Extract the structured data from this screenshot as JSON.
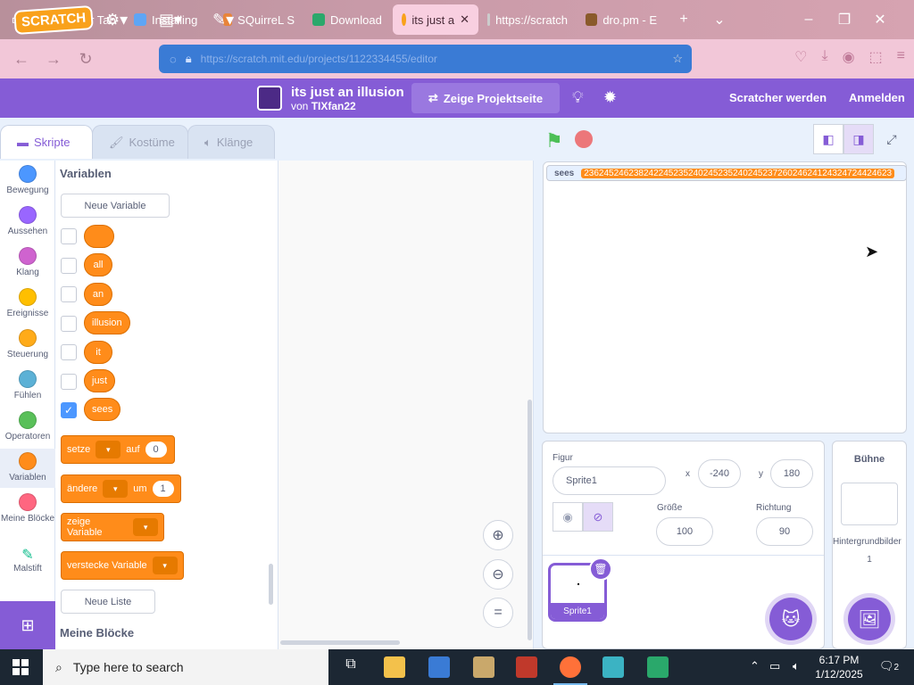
{
  "browser": {
    "tabs": [
      {
        "title": "Neuer Tab",
        "color": "#ff7139"
      },
      {
        "title": "Installing",
        "color": "#5ea5f5"
      },
      {
        "title": "SQuirreL S",
        "color": "#e8843a"
      },
      {
        "title": "Download",
        "color": "#2aa86b"
      },
      {
        "title": "its just a",
        "color": "#f9a11b",
        "active": true
      },
      {
        "title": "https://scratch",
        "color": "#cccccc"
      },
      {
        "title": "dro.pm - E",
        "color": "#8a5a2b"
      }
    ],
    "tab_close": "✕",
    "new_tab": "+",
    "url": "https://scratch.mit.edu/projects/1122334455/editor",
    "colors": {
      "tabbar": "#c89aa8",
      "urlbar": "#3a7bd5"
    }
  },
  "scratch": {
    "logo": "SCRATCH",
    "project_title": "its just an illusion",
    "author_prefix": "von",
    "author": "TIXfan22",
    "see_project": "Zeige Projektseite",
    "join": "Scratcher werden",
    "login": "Anmelden",
    "colors": {
      "menu": "#855cd6",
      "variables": "#ff8c1a"
    }
  },
  "tabs": {
    "code": "Skripte",
    "costumes": "Kostüme",
    "sounds": "Klänge"
  },
  "categories": [
    {
      "label": "Bewegung",
      "color": "#4c97ff"
    },
    {
      "label": "Aussehen",
      "color": "#9966ff"
    },
    {
      "label": "Klang",
      "color": "#cf63cf"
    },
    {
      "label": "Ereignisse",
      "color": "#ffbf00"
    },
    {
      "label": "Steuerung",
      "color": "#ffab19"
    },
    {
      "label": "Fühlen",
      "color": "#5cb1d6"
    },
    {
      "label": "Operatoren",
      "color": "#59c059"
    },
    {
      "label": "Variablen",
      "color": "#ff8c1a"
    },
    {
      "label": "Meine Blöcke",
      "color": "#ff6680"
    },
    {
      "label": "Malstift",
      "color": "#0fbd8c"
    }
  ],
  "palette": {
    "heading": "Variablen",
    "new_variable": "Neue Variable",
    "variables": [
      {
        "name": "",
        "checked": false
      },
      {
        "name": "all",
        "checked": false
      },
      {
        "name": "an",
        "checked": false
      },
      {
        "name": "illusion",
        "checked": false
      },
      {
        "name": "it",
        "checked": false
      },
      {
        "name": "just",
        "checked": false
      },
      {
        "name": "sees",
        "checked": true
      }
    ],
    "set_block": {
      "label": "setze",
      "to": "auf",
      "value": "0"
    },
    "change_block": {
      "label": "ändere",
      "by": "um",
      "value": "1"
    },
    "show_block": "zeige Variable",
    "hide_block": "verstecke Variable",
    "new_list": "Neue Liste",
    "my_blocks": "Meine Blöcke"
  },
  "stage": {
    "monitor_label": "sees",
    "monitor_value": "23624524623824224523524024523524024523726024624124324724424623"
  },
  "sprite_info": {
    "sprite_label": "Figur",
    "sprite_name": "Sprite1",
    "x_label": "x",
    "x_value": "-240",
    "y_label": "y",
    "y_value": "180",
    "size_label": "Größe",
    "size_value": "100",
    "direction_label": "Richtung",
    "direction_value": "90"
  },
  "sprites": [
    {
      "name": "Sprite1"
    }
  ],
  "stage_target": {
    "title": "Bühne",
    "backdrops_label": "Hintergrundbilder",
    "backdrops_count": "1"
  },
  "taskbar": {
    "search_placeholder": "Type here to search",
    "time": "6:17 PM",
    "date": "1/12/2025",
    "notification_count": "2"
  }
}
